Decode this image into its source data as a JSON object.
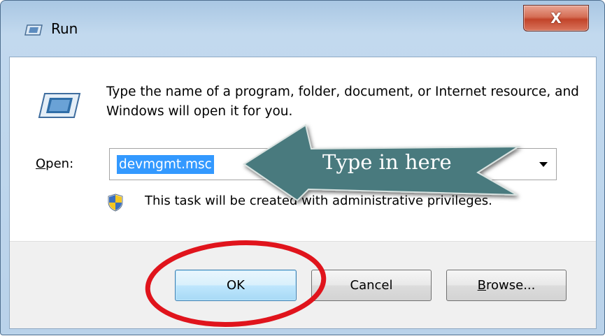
{
  "window": {
    "title": "Run",
    "close_label": "X",
    "title_icon": "run-icon",
    "close_icon": "close-icon"
  },
  "content": {
    "description": "Type the name of a program, folder, document, or Internet resource, and Windows will open it for you.",
    "open_label": "Open:",
    "command_value": "devmgmt.msc",
    "admin_notice": "This task will be created with administrative privileges.",
    "shield_icon": "uac-shield-icon"
  },
  "buttons": {
    "ok": "OK",
    "cancel": "Cancel",
    "browse": "Browse..."
  },
  "annotation": {
    "arrow_text": "Type in here"
  },
  "colors": {
    "selection": "#3399ff",
    "arrow_fill": "#4a7a7e",
    "circle": "#e0141c"
  }
}
